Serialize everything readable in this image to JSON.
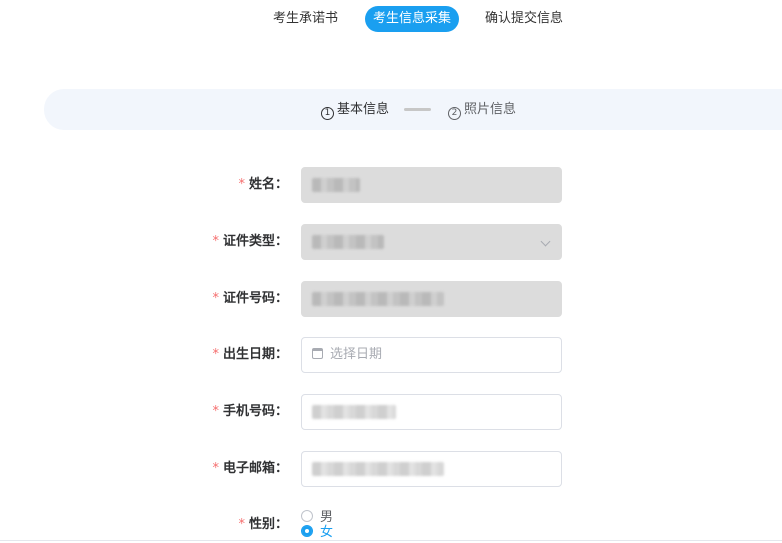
{
  "tabs": [
    {
      "label": "考生承诺书"
    },
    {
      "label": "考生信息采集"
    },
    {
      "label": "确认提交信息"
    }
  ],
  "steps": {
    "step1": {
      "number": "1",
      "label": "基本信息"
    },
    "step2": {
      "number": "2",
      "label": "照片信息"
    }
  },
  "form": {
    "required_mark": "*",
    "name": {
      "label": "姓名："
    },
    "id_type": {
      "label": "证件类型："
    },
    "id_number": {
      "label": "证件号码："
    },
    "birth_date": {
      "label": "出生日期：",
      "placeholder": "选择日期"
    },
    "phone": {
      "label": "手机号码："
    },
    "email": {
      "label": "电子邮箱："
    },
    "gender": {
      "label": "性别：",
      "options": [
        "男",
        "女"
      ],
      "selected": "女"
    }
  },
  "colors": {
    "accent": "#1a9ff0",
    "required": "#f56c6c",
    "step_bar": "#f2f6fc",
    "disabled": "#dcdcdc"
  }
}
